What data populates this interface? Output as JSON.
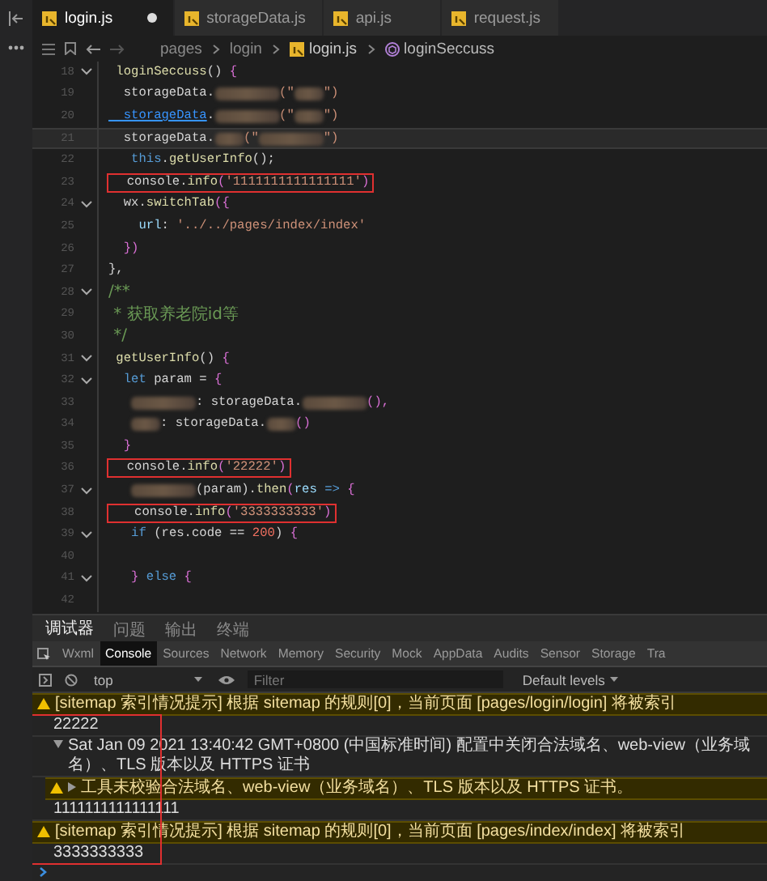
{
  "editor_tabs": [
    {
      "label": "login.js",
      "selected": true,
      "modified": true
    },
    {
      "label": "storageData.js",
      "selected": false,
      "modified": false
    },
    {
      "label": "api.js",
      "selected": false,
      "modified": false
    },
    {
      "label": "request.js",
      "selected": false,
      "modified": false
    }
  ],
  "breadcrumb": [
    {
      "label": "pages",
      "kind": "folder"
    },
    {
      "label": "login",
      "kind": "folder"
    },
    {
      "label": "login.js",
      "kind": "file"
    },
    {
      "label": "loginSeccuss",
      "kind": "method"
    }
  ],
  "code_lines": [
    {
      "number": "18",
      "foldable": true,
      "current": false,
      "boxed": false,
      "tokens": [
        {
          "kind": "fn",
          "text": " loginSeccuss"
        },
        {
          "kind": "plain",
          "text": "() "
        },
        {
          "kind": "brace",
          "text": "{"
        }
      ]
    },
    {
      "number": "19",
      "foldable": false,
      "current": false,
      "boxed": false,
      "tokens": [
        {
          "kind": "plain",
          "text": "  storageData."
        },
        {
          "kind": "blur-long"
        },
        {
          "kind": "str",
          "text": "(\""
        },
        {
          "kind": "blur-short"
        },
        {
          "kind": "str",
          "text": "\")"
        }
      ]
    },
    {
      "number": "20",
      "foldable": false,
      "current": false,
      "boxed": false,
      "tokens": [
        {
          "kind": "link",
          "text": "  storageData"
        },
        {
          "kind": "plain",
          "text": "."
        },
        {
          "kind": "blur-long"
        },
        {
          "kind": "str",
          "text": "(\""
        },
        {
          "kind": "blur-short"
        },
        {
          "kind": "str",
          "text": "\")"
        }
      ]
    },
    {
      "number": "21",
      "foldable": false,
      "current": true,
      "boxed": false,
      "tokens": [
        {
          "kind": "plain",
          "text": "  storageData."
        },
        {
          "kind": "blur-short"
        },
        {
          "kind": "str",
          "text": "(\""
        },
        {
          "kind": "blur-long"
        },
        {
          "kind": "str",
          "text": "\")"
        }
      ]
    },
    {
      "number": "22",
      "foldable": false,
      "current": false,
      "boxed": false,
      "tokens": [
        {
          "kind": "kw",
          "text": "   this"
        },
        {
          "kind": "plain",
          "text": "."
        },
        {
          "kind": "fn",
          "text": "getUserInfo"
        },
        {
          "kind": "plain",
          "text": "();"
        }
      ]
    },
    {
      "number": "23",
      "foldable": false,
      "current": false,
      "boxed": true,
      "tokens": [
        {
          "kind": "plain",
          "text": "  console."
        },
        {
          "kind": "fn",
          "text": "info"
        },
        {
          "kind": "brace",
          "text": "("
        },
        {
          "kind": "str",
          "text": "'1111111111111111'"
        },
        {
          "kind": "brace",
          "text": ")"
        }
      ]
    },
    {
      "number": "24",
      "foldable": true,
      "current": false,
      "boxed": false,
      "tokens": [
        {
          "kind": "plain",
          "text": "  wx."
        },
        {
          "kind": "fn",
          "text": "switchTab"
        },
        {
          "kind": "brace",
          "text": "({"
        }
      ]
    },
    {
      "number": "25",
      "foldable": false,
      "current": false,
      "boxed": false,
      "tokens": [
        {
          "kind": "prop",
          "text": "    url"
        },
        {
          "kind": "plain",
          "text": ": "
        },
        {
          "kind": "str",
          "text": "'../../pages/index/index'"
        }
      ]
    },
    {
      "number": "26",
      "foldable": false,
      "current": false,
      "boxed": false,
      "tokens": [
        {
          "kind": "brace",
          "text": "  })"
        }
      ]
    },
    {
      "number": "27",
      "foldable": false,
      "current": false,
      "boxed": false,
      "tokens": [
        {
          "kind": "plain",
          "text": "},"
        }
      ]
    },
    {
      "number": "28",
      "foldable": true,
      "current": false,
      "boxed": false,
      "tokens": [
        {
          "kind": "comment",
          "text": "/**"
        }
      ]
    },
    {
      "number": "29",
      "foldable": false,
      "current": false,
      "boxed": false,
      "tokens": [
        {
          "kind": "comment",
          "text": " * 获取养老院id等"
        }
      ]
    },
    {
      "number": "30",
      "foldable": false,
      "current": false,
      "boxed": false,
      "tokens": [
        {
          "kind": "comment",
          "text": " */"
        }
      ]
    },
    {
      "number": "31",
      "foldable": true,
      "current": false,
      "boxed": false,
      "tokens": [
        {
          "kind": "fn",
          "text": " getUserInfo"
        },
        {
          "kind": "plain",
          "text": "() "
        },
        {
          "kind": "brace",
          "text": "{"
        }
      ]
    },
    {
      "number": "32",
      "foldable": true,
      "current": false,
      "boxed": false,
      "tokens": [
        {
          "kind": "kw",
          "text": "  let"
        },
        {
          "kind": "plain",
          "text": " param = "
        },
        {
          "kind": "brace",
          "text": "{"
        }
      ]
    },
    {
      "number": "33",
      "foldable": false,
      "current": false,
      "boxed": false,
      "tokens": [
        {
          "kind": "blur-long"
        },
        {
          "kind": "plain",
          "text": ": storageData."
        },
        {
          "kind": "blur-long"
        },
        {
          "kind": "brace",
          "text": "(),"
        }
      ]
    },
    {
      "number": "34",
      "foldable": false,
      "current": false,
      "boxed": false,
      "tokens": [
        {
          "kind": "blur-short"
        },
        {
          "kind": "plain",
          "text": ": storageData."
        },
        {
          "kind": "blur-short"
        },
        {
          "kind": "brace",
          "text": "()"
        }
      ]
    },
    {
      "number": "35",
      "foldable": false,
      "current": false,
      "boxed": false,
      "tokens": [
        {
          "kind": "brace",
          "text": "  }"
        }
      ]
    },
    {
      "number": "36",
      "foldable": false,
      "current": false,
      "boxed": true,
      "tokens": [
        {
          "kind": "plain",
          "text": "  console."
        },
        {
          "kind": "fn",
          "text": "info"
        },
        {
          "kind": "brace",
          "text": "("
        },
        {
          "kind": "str",
          "text": "'22222'"
        },
        {
          "kind": "brace",
          "text": ")"
        }
      ]
    },
    {
      "number": "37",
      "foldable": true,
      "current": false,
      "boxed": false,
      "tokens": [
        {
          "kind": "blur-long"
        },
        {
          "kind": "plain",
          "text": "(param)."
        },
        {
          "kind": "fn",
          "text": "then"
        },
        {
          "kind": "brace",
          "text": "("
        },
        {
          "kind": "prop",
          "text": "res"
        },
        {
          "kind": "kw",
          "text": " => "
        },
        {
          "kind": "brace",
          "text": "{"
        }
      ]
    },
    {
      "number": "38",
      "foldable": false,
      "current": false,
      "boxed": true,
      "tokens": [
        {
          "kind": "plain",
          "text": "   console."
        },
        {
          "kind": "fn",
          "text": "info"
        },
        {
          "kind": "brace",
          "text": "("
        },
        {
          "kind": "str",
          "text": "'3333333333'"
        },
        {
          "kind": "brace",
          "text": ")"
        }
      ]
    },
    {
      "number": "39",
      "foldable": true,
      "current": false,
      "boxed": false,
      "tokens": [
        {
          "kind": "kw",
          "text": "   if"
        },
        {
          "kind": "plain",
          "text": " (res.code == "
        },
        {
          "kind": "num",
          "text": "200"
        },
        {
          "kind": "plain",
          "text": ") "
        },
        {
          "kind": "brace",
          "text": "{"
        }
      ]
    },
    {
      "number": "40",
      "foldable": false,
      "current": false,
      "boxed": false
    },
    {
      "number": "41",
      "foldable": true,
      "current": false,
      "boxed": false,
      "tokens": [
        {
          "kind": "brace",
          "text": "   }"
        },
        {
          "kind": "kw",
          "text": " else "
        },
        {
          "kind": "brace",
          "text": "{"
        }
      ]
    },
    {
      "number": "42",
      "foldable": false,
      "current": false,
      "boxed": false
    }
  ],
  "panel_tabs": [
    {
      "label": "调试器",
      "selected": true
    },
    {
      "label": "问题",
      "selected": false
    },
    {
      "label": "输出",
      "selected": false
    },
    {
      "label": "终端",
      "selected": false
    }
  ],
  "devtools_tabs": [
    {
      "label": "Wxml",
      "selected": false
    },
    {
      "label": "Console",
      "selected": true
    },
    {
      "label": "Sources",
      "selected": false
    },
    {
      "label": "Network",
      "selected": false
    },
    {
      "label": "Memory",
      "selected": false
    },
    {
      "label": "Security",
      "selected": false
    },
    {
      "label": "Mock",
      "selected": false
    },
    {
      "label": "AppData",
      "selected": false
    },
    {
      "label": "Audits",
      "selected": false
    },
    {
      "label": "Sensor",
      "selected": false
    },
    {
      "label": "Storage",
      "selected": false
    },
    {
      "label": "Tra",
      "selected": false
    }
  ],
  "console_toolbar": {
    "context": "top",
    "filter_placeholder": "Filter",
    "levels": "Default levels"
  },
  "console_messages": [
    {
      "kind": "warn",
      "annotated": false,
      "text": "[sitemap 索引情况提示] 根据 sitemap 的规则[0]，当前页面 [pages/login/login] 将被索引"
    },
    {
      "kind": "log",
      "annotated": true,
      "text": "22222"
    },
    {
      "kind": "group",
      "annotated": true,
      "expanded": true,
      "text": "Sat Jan 09 2021 13:40:42 GMT+0800 (中国标准时间) 配置中关闭合法域名、web-view（业务域名）、TLS 版本以及 HTTPS 证书",
      "children": [
        {
          "kind": "warn",
          "expanded": false,
          "text": "工具未校验合法域名、web-view（业务域名）、TLS 版本以及 HTTPS 证书。"
        }
      ]
    },
    {
      "kind": "log",
      "annotated": true,
      "text": "1111111111111111"
    },
    {
      "kind": "warn",
      "annotated": true,
      "text": "[sitemap 索引情况提示] 根据 sitemap 的规则[0]，当前页面 [pages/index/index] 将被索引"
    },
    {
      "kind": "log",
      "annotated": true,
      "text": "3333333333"
    }
  ]
}
